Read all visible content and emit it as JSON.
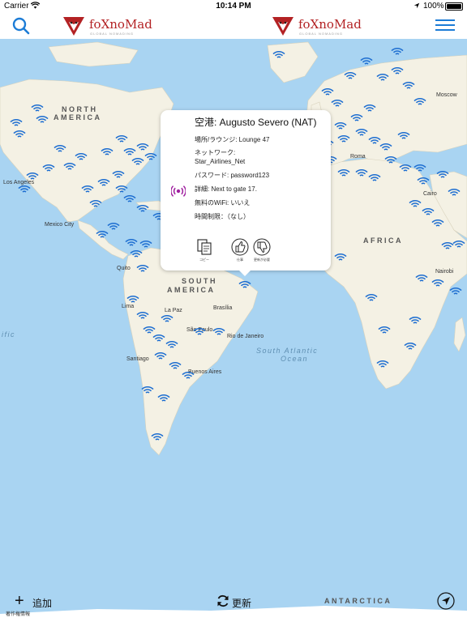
{
  "status_bar": {
    "carrier": "Carrier",
    "time": "10:14 PM",
    "battery": "100%"
  },
  "nav": {
    "brand_name": "foXnoMad",
    "brand_tagline": "GLOBAL NOMADING",
    "search_icon": "search-icon",
    "menu_icon": "hamburger-menu-icon",
    "accent_color": "#1c7cd6",
    "brand_color": "#b32224"
  },
  "map": {
    "regions": {
      "north_america_1": "NORTH",
      "north_america_2": "AMERICA",
      "south_america_1": "SOUTH",
      "south_america_2": "AMERICA",
      "africa": "AFRICA",
      "antarctica": "ANTARCTICA"
    },
    "oceans": {
      "atlantic_south_1": "South Atlantic",
      "atlantic_south_2": "Ocean",
      "pacific_fragment": "ific"
    },
    "cities": {
      "los_angeles": "Los Angeles",
      "mexico_city": "Mexico City",
      "quito": "Quito",
      "lima": "Lima",
      "la_paz": "La Paz",
      "brasilia": "Brasília",
      "sao_paulo": "São Paulo",
      "rio": "Rio de Janeiro",
      "santiago": "Santiago",
      "buenos_aires": "Buenos Aires",
      "cairo": "Cairo",
      "nairobi": "Nairobi",
      "moscow": "Moscow",
      "roma": "Roma"
    },
    "hotspot_icon": "wifi-hotspot-icon",
    "hotspot_color": "#1f6fd1",
    "land_color": "#f4f1e4",
    "water_color": "#a9d4f2"
  },
  "callout": {
    "title": "空港: Augusto Severo (NAT)",
    "location": "場所/ラウンジ: Lounge 47",
    "network_label": "ネットワーク:",
    "network_value": "Star_Airlines_Net",
    "password": "パスワード: password123",
    "details": "詳細: Next to gate 17.",
    "free_wifi": "無料のWiFi: いいえ",
    "time_limit": "時間制限：（なし）",
    "pin_icon": "broadcast-icon",
    "pin_color": "#a020a0",
    "actions": {
      "copy": "コピー",
      "works": "仕事",
      "needs_update": "更新が必要"
    }
  },
  "bottom_bar": {
    "add_label": "追加",
    "legal_label": "著作権情報",
    "refresh_label": "更新",
    "locate_icon": "location-arrow-icon"
  }
}
